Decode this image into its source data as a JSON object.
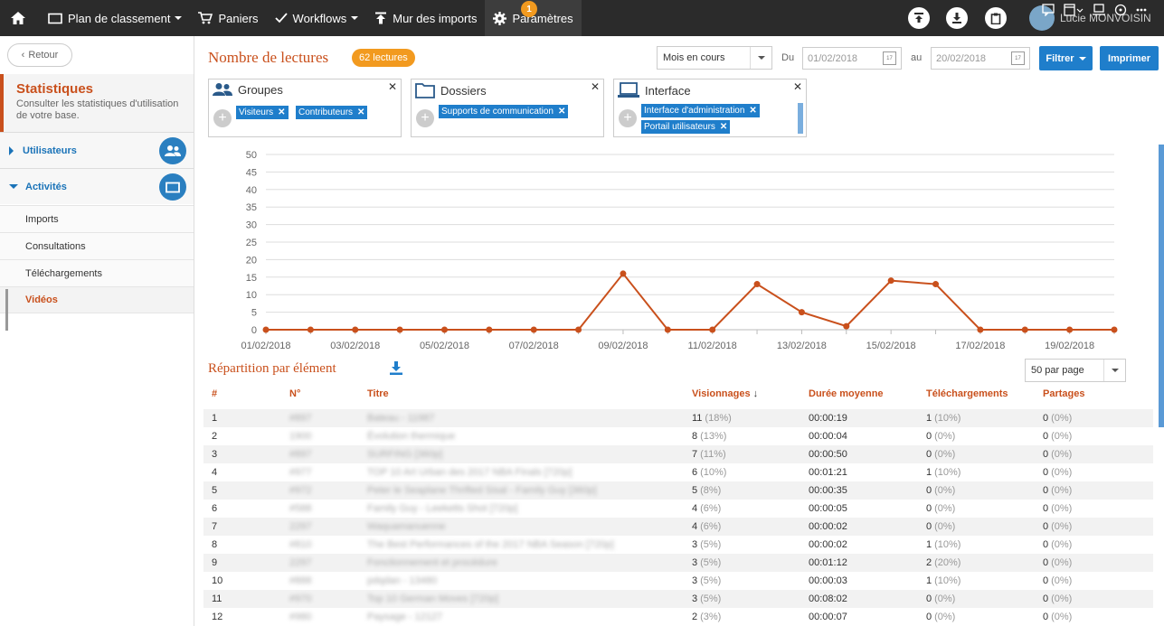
{
  "topbar": {
    "items": [
      {
        "label": "Plan de classement",
        "icon": "folder-icon",
        "caret": true
      },
      {
        "label": "Paniers",
        "icon": "cart-icon",
        "caret": false
      },
      {
        "label": "Workflows",
        "icon": "check-icon",
        "caret": true
      },
      {
        "label": "Mur des imports",
        "icon": "upload-icon",
        "caret": false
      },
      {
        "label": "Paramètres",
        "icon": "gear-icon",
        "caret": false
      }
    ],
    "notification_count": "1",
    "user_name": "Lucie MONVOISIN"
  },
  "sidebar": {
    "back_label": "Retour",
    "title": "Statistiques",
    "description": "Consulter les statistiques d'utilisation de votre base.",
    "sections": [
      {
        "label": "Utilisateurs",
        "icon": "users-icon"
      },
      {
        "label": "Activités",
        "icon": "folder-icon"
      }
    ],
    "subitems": [
      "Imports",
      "Consultations",
      "Téléchargements",
      "Vidéos"
    ]
  },
  "header": {
    "title": "Nombre de lectures",
    "count_badge": "62 lectures",
    "period": "Mois en cours",
    "from_label": "Du",
    "from_date": "01/02/2018",
    "to_label": "au",
    "to_date": "20/02/2018",
    "filter_label": "Filtrer",
    "print_label": "Imprimer"
  },
  "facets": [
    {
      "title": "Groupes",
      "icon": "users-icon",
      "chips": [
        "Visiteurs",
        "Contributeurs"
      ]
    },
    {
      "title": "Dossiers",
      "icon": "folder-icon",
      "chips": [
        "Supports de communication"
      ]
    },
    {
      "title": "Interface",
      "icon": "monitor-icon",
      "chips": [
        "Interface d'administration",
        "Portail utilisateurs"
      ]
    }
  ],
  "chart_data": {
    "type": "line",
    "x": [
      "01/02/2018",
      "02/02/2018",
      "03/02/2018",
      "04/02/2018",
      "05/02/2018",
      "06/02/2018",
      "07/02/2018",
      "08/02/2018",
      "09/02/2018",
      "10/02/2018",
      "11/02/2018",
      "12/02/2018",
      "13/02/2018",
      "14/02/2018",
      "15/02/2018",
      "16/02/2018",
      "17/02/2018",
      "18/02/2018",
      "19/02/2018",
      "20/02/2018"
    ],
    "x_tick_labels": [
      "01/02/2018",
      "03/02/2018",
      "05/02/2018",
      "07/02/2018",
      "09/02/2018",
      "11/02/2018",
      "13/02/2018",
      "15/02/2018",
      "17/02/2018",
      "19/02/2018"
    ],
    "values": [
      0,
      0,
      0,
      0,
      0,
      0,
      0,
      0,
      16,
      0,
      0,
      13,
      5,
      1,
      14,
      13,
      0,
      0,
      0,
      0
    ],
    "ylim": [
      0,
      50
    ],
    "y_ticks": [
      0,
      5,
      10,
      15,
      20,
      25,
      30,
      35,
      40,
      45,
      50
    ],
    "grid": true,
    "color": "#c9501c"
  },
  "repartition": {
    "title": "Répartition par élément",
    "per_page": "50 par page",
    "columns": [
      "#",
      "N°",
      "Titre",
      "Visionnages",
      "Durée moyenne",
      "Téléchargements",
      "Partages"
    ],
    "rows": [
      {
        "idx": "1",
        "num": "#897",
        "title": "Bateau - 11987",
        "views": "11",
        "views_pct": "(18%)",
        "duration": "00:00:19",
        "dl": "1",
        "dl_pct": "(10%)",
        "shares": "0",
        "shares_pct": "(0%)"
      },
      {
        "idx": "2",
        "num": "1900",
        "title": "Évolution thermique",
        "views": "8",
        "views_pct": "(13%)",
        "duration": "00:00:04",
        "dl": "0",
        "dl_pct": "(0%)",
        "shares": "0",
        "shares_pct": "(0%)"
      },
      {
        "idx": "3",
        "num": "#897",
        "title": "SURFING [360p]",
        "views": "7",
        "views_pct": "(11%)",
        "duration": "00:00:50",
        "dl": "0",
        "dl_pct": "(0%)",
        "shares": "0",
        "shares_pct": "(0%)"
      },
      {
        "idx": "4",
        "num": "#977",
        "title": "TOP 10 Art Urban des 2017 NBA Finals [720p]",
        "views": "6",
        "views_pct": "(10%)",
        "duration": "00:01:21",
        "dl": "1",
        "dl_pct": "(10%)",
        "shares": "0",
        "shares_pct": "(0%)"
      },
      {
        "idx": "5",
        "num": "#972",
        "title": "Peter le Seaplane Thrifted Sisal - Family Guy [360p]",
        "views": "5",
        "views_pct": "(8%)",
        "duration": "00:00:35",
        "dl": "0",
        "dl_pct": "(0%)",
        "shares": "0",
        "shares_pct": "(0%)"
      },
      {
        "idx": "6",
        "num": "#588",
        "title": "Family Guy - Leeketts Shot [720p]",
        "views": "4",
        "views_pct": "(6%)",
        "duration": "00:00:05",
        "dl": "0",
        "dl_pct": "(0%)",
        "shares": "0",
        "shares_pct": "(0%)"
      },
      {
        "idx": "7",
        "num": "2297",
        "title": "Waquamanuenne",
        "views": "4",
        "views_pct": "(6%)",
        "duration": "00:00:02",
        "dl": "0",
        "dl_pct": "(0%)",
        "shares": "0",
        "shares_pct": "(0%)"
      },
      {
        "idx": "8",
        "num": "#810",
        "title": "The Best Performances of the 2017 NBA Season [720p]",
        "views": "3",
        "views_pct": "(5%)",
        "duration": "00:00:02",
        "dl": "1",
        "dl_pct": "(10%)",
        "shares": "0",
        "shares_pct": "(0%)"
      },
      {
        "idx": "9",
        "num": "2297",
        "title": "Fonctionnement et procédure",
        "views": "3",
        "views_pct": "(5%)",
        "duration": "00:01:12",
        "dl": "2",
        "dl_pct": "(20%)",
        "shares": "0",
        "shares_pct": "(0%)"
      },
      {
        "idx": "10",
        "num": "#888",
        "title": "pdqdan - 13480",
        "views": "3",
        "views_pct": "(5%)",
        "duration": "00:00:03",
        "dl": "1",
        "dl_pct": "(10%)",
        "shares": "0",
        "shares_pct": "(0%)"
      },
      {
        "idx": "11",
        "num": "#970",
        "title": "Top 10 German Moves [720p]",
        "views": "3",
        "views_pct": "(5%)",
        "duration": "00:08:02",
        "dl": "0",
        "dl_pct": "(0%)",
        "shares": "0",
        "shares_pct": "(0%)"
      },
      {
        "idx": "12",
        "num": "#980",
        "title": "Paysage - 12127",
        "views": "2",
        "views_pct": "(3%)",
        "duration": "00:00:07",
        "dl": "0",
        "dl_pct": "(0%)",
        "shares": "0",
        "shares_pct": "(0%)"
      }
    ]
  }
}
